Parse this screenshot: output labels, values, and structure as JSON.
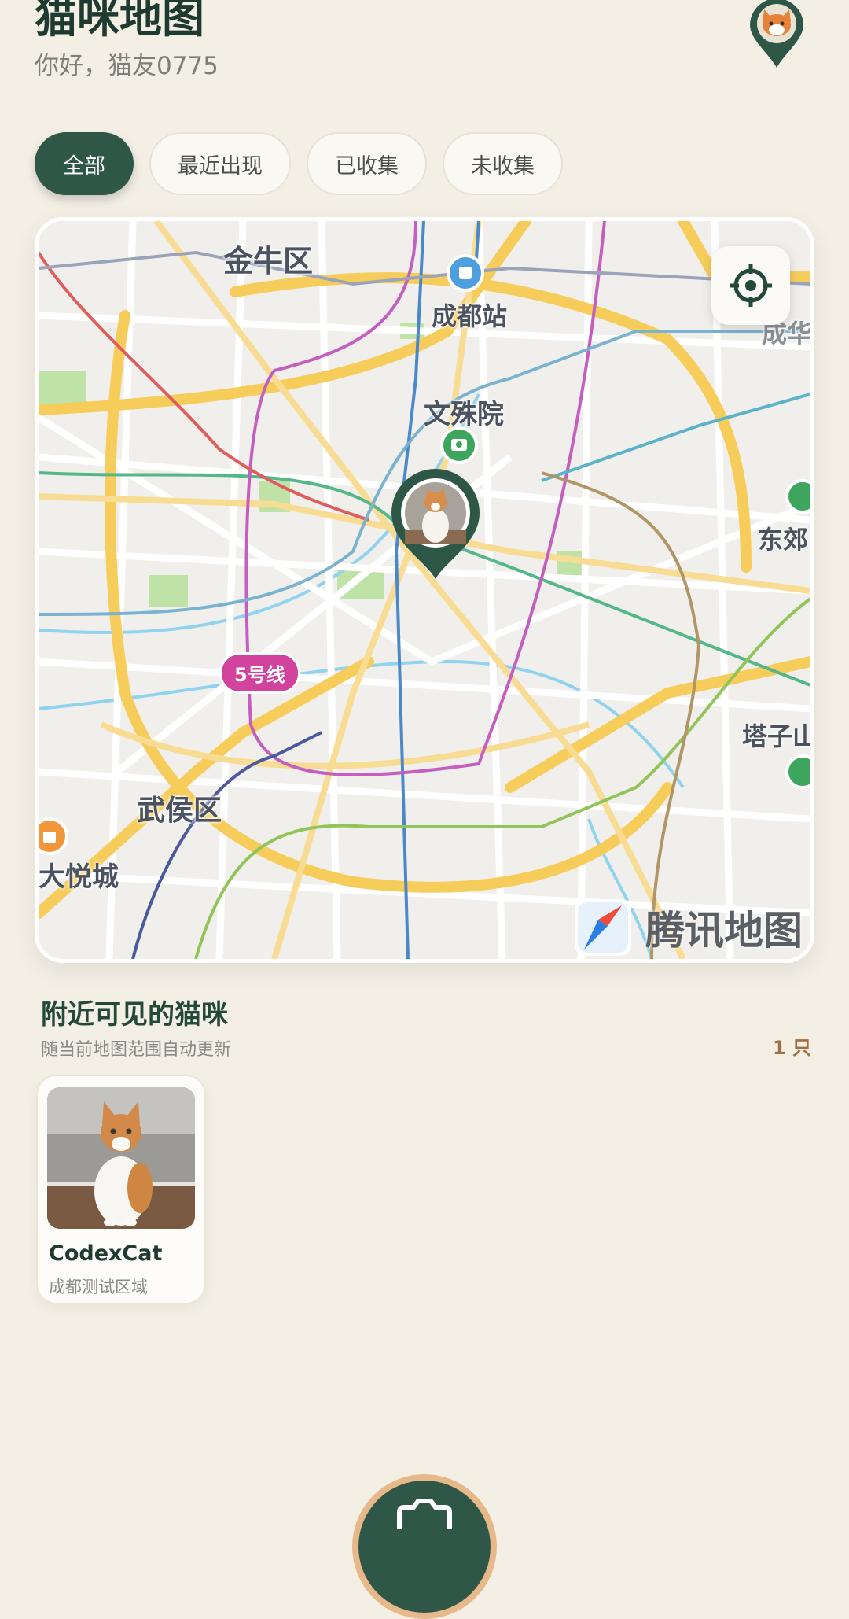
{
  "header": {
    "title": "猫咪地图",
    "greeting": "你好，猫友0775"
  },
  "filters": [
    {
      "label": "全部",
      "active": true
    },
    {
      "label": "最近出现",
      "active": false
    },
    {
      "label": "已收集",
      "active": false
    },
    {
      "label": "未收集",
      "active": false
    }
  ],
  "map": {
    "labels": {
      "jinniu": "金牛区",
      "chengdu_station": "成都站",
      "wenshuyuan": "文殊院",
      "dongjiao": "东郊",
      "tazishan": "塔子山",
      "wuhou": "武侯区",
      "dayuecheng": "大悦城",
      "chenghua": "成华"
    },
    "metro_badge": "5号线",
    "brand": "腾讯地图"
  },
  "nearby": {
    "title": "附近可见的猫咪",
    "subtitle": "随当前地图范围自动更新",
    "count": "1 只",
    "cats": [
      {
        "name": "CodexCat",
        "area": "成都测试区域"
      }
    ]
  },
  "colors": {
    "primary": "#2f5747",
    "background": "#f3efe5",
    "accent": "#a26d3f"
  }
}
